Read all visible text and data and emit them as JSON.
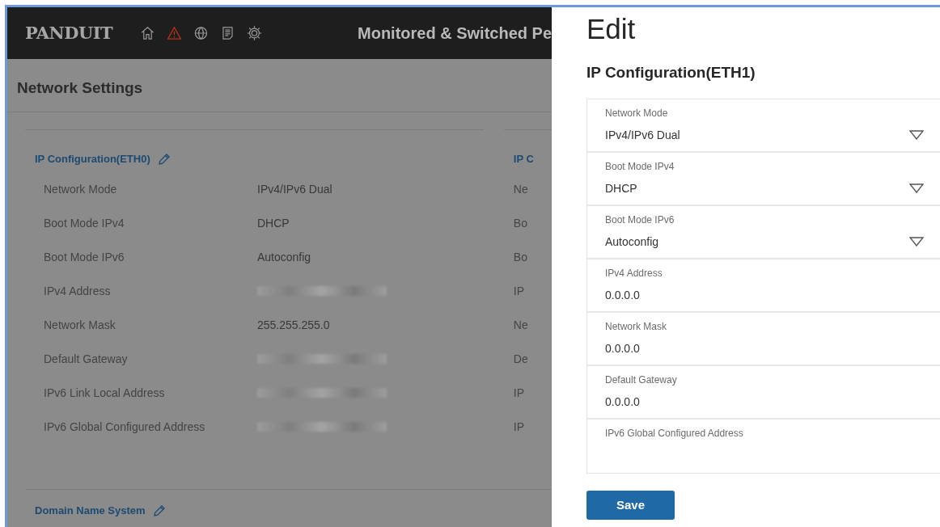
{
  "header": {
    "logo": "PANDUIT",
    "title": "Monitored & Switched Pe",
    "nav_icons": [
      {
        "kind": "home",
        "alert": false
      },
      {
        "kind": "warning",
        "alert": true
      },
      {
        "kind": "globe",
        "alert": false
      },
      {
        "kind": "document",
        "alert": false
      },
      {
        "kind": "gear",
        "alert": false
      }
    ]
  },
  "page": {
    "title": "Network Settings",
    "sections": [
      {
        "title": "IP Configuration(ETH0)",
        "editable": true,
        "rows": [
          {
            "label": "Network Mode",
            "value": "IPv4/IPv6 Dual",
            "redacted": false
          },
          {
            "label": "Boot Mode IPv4",
            "value": "DHCP",
            "redacted": false
          },
          {
            "label": "Boot Mode IPv6",
            "value": "Autoconfig",
            "redacted": false
          },
          {
            "label": "IPv4 Address",
            "redacted": true
          },
          {
            "label": "Network Mask",
            "value": "255.255.255.0",
            "redacted": false
          },
          {
            "label": "Default Gateway",
            "redacted": true
          },
          {
            "label": "IPv6 Link Local Address",
            "redacted": true
          },
          {
            "label": "IPv6 Global Configured Address",
            "redacted": true
          }
        ]
      }
    ],
    "second_column": {
      "title": "IP C",
      "labels": [
        "Ne",
        "Bo",
        "Bo",
        "IP",
        "Ne",
        "De",
        "IP",
        "IP"
      ]
    },
    "next_section": {
      "title": "Domain Name System",
      "editable": true
    }
  },
  "drawer": {
    "title": "Edit",
    "subtitle": "IP Configuration(ETH1)",
    "fields": [
      {
        "kind": "select",
        "label": "Network Mode",
        "value": "IPv4/IPv6 Dual"
      },
      {
        "kind": "select",
        "label": "Boot Mode IPv4",
        "value": "DHCP"
      },
      {
        "kind": "select",
        "label": "Boot Mode IPv6",
        "value": "Autoconfig"
      },
      {
        "kind": "text",
        "label": "IPv4 Address",
        "value": "0.0.0.0"
      },
      {
        "kind": "text",
        "label": "Network Mask",
        "value": "0.0.0.0"
      },
      {
        "kind": "text",
        "label": "Default Gateway",
        "value": "0.0.0.0"
      },
      {
        "kind": "text",
        "label": "IPv6 Global Configured Address"
      }
    ],
    "save_button": "Save"
  }
}
